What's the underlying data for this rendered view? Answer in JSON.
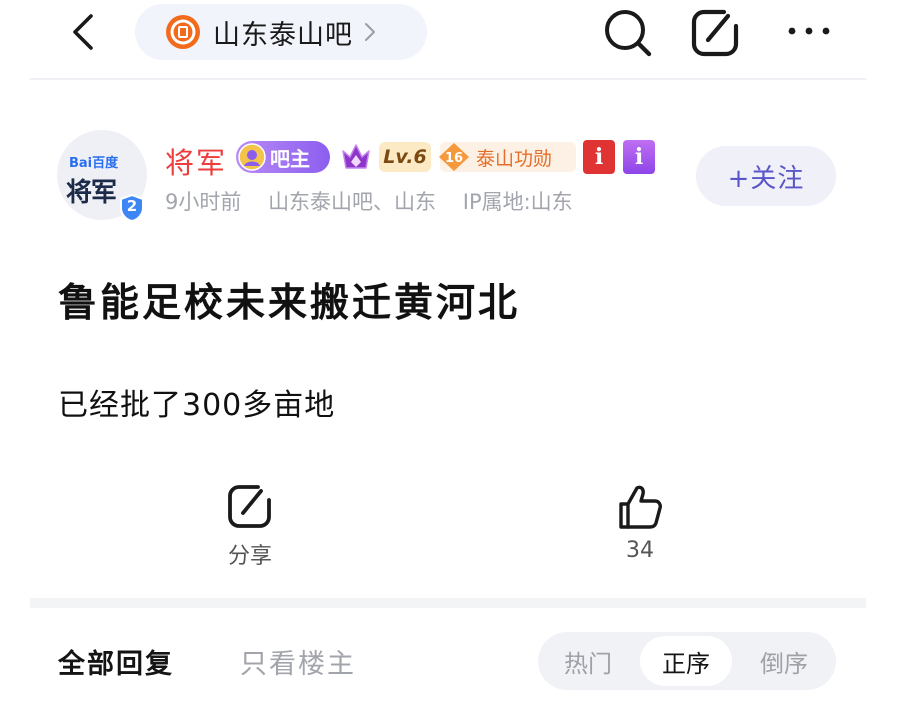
{
  "topbar": {
    "forum_name": "山东泰山吧",
    "icons": [
      "back-icon",
      "forum-logo-icon",
      "chevron-right-icon",
      "search-icon",
      "share-icon",
      "more-icon"
    ]
  },
  "author": {
    "avatar_top_text": "Bai百度",
    "avatar_main_text": "将军",
    "avatar_badge_number": "2",
    "name": "将军",
    "owner_badge": "吧主",
    "level": "Lv.6",
    "merit_level": "16",
    "merit_label": "泰山功勋",
    "info_badge_text": "i",
    "meta": {
      "time": "9小时前",
      "source": "山东泰山吧、山东",
      "ip": "IP属地:山东"
    },
    "follow_label": "+关注"
  },
  "post": {
    "title": "鲁能足校未来搬迁黄河北",
    "body": "已经批了300多亩地"
  },
  "actions": {
    "share_label": "分享",
    "like_count": "34"
  },
  "replies": {
    "tab_all": "全部回复",
    "tab_op": "只看楼主",
    "sort": {
      "options": [
        "热门",
        "正序",
        "倒序"
      ],
      "selected": "正序"
    }
  },
  "colors": {
    "author_name": "#ee3d3d",
    "follow_text": "#5a55c8",
    "owner_badge": "#8c5ef0",
    "merit_text": "#e56f2a",
    "meta_text": "#a2a5ad"
  }
}
